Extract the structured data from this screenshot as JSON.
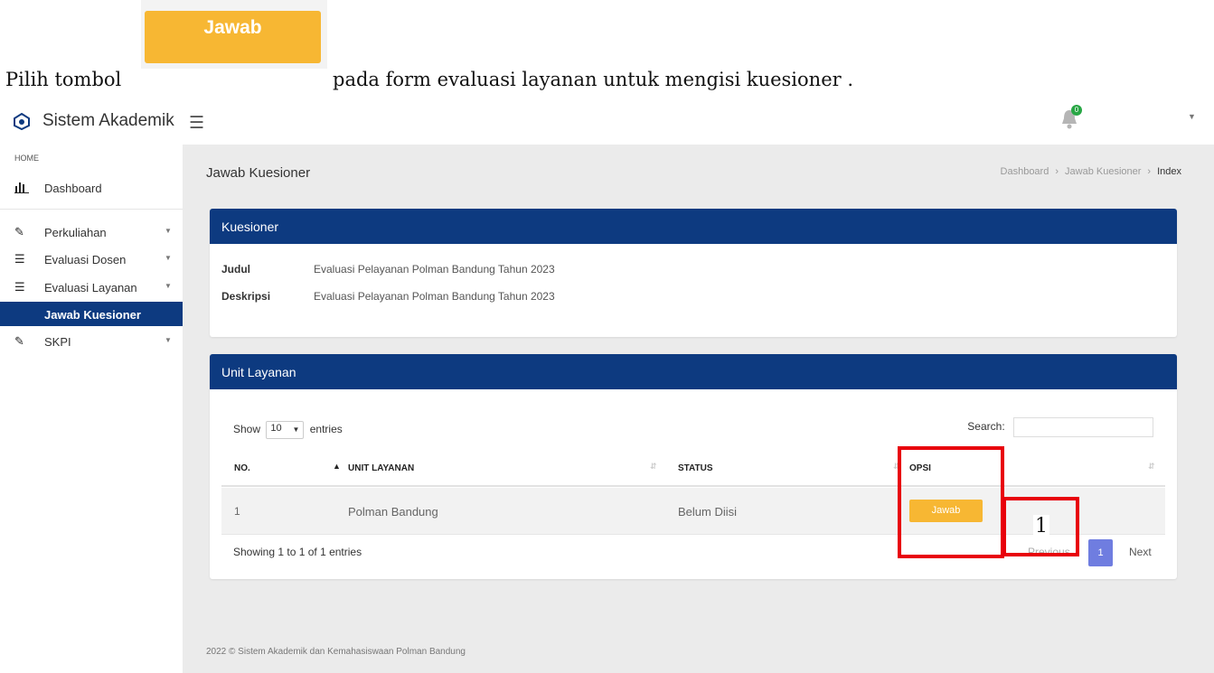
{
  "instruction": {
    "pre_text": "Pilih tombol",
    "button_label": "Jawab",
    "post_text": "pada form evaluasi layanan untuk mengisi kuesioner ."
  },
  "topbar": {
    "brand": "Sistem Akademik",
    "notification_count": "0"
  },
  "sidebar": {
    "header": "HOME",
    "items": [
      {
        "label": "Dashboard",
        "icon": "bar-chart-icon"
      },
      {
        "label": "Perkuliahan",
        "icon": "pencil-icon"
      },
      {
        "label": "Evaluasi Dosen",
        "icon": "list-icon"
      },
      {
        "label": "Evaluasi Layanan",
        "icon": "list-icon"
      },
      {
        "label": "Jawab Kuesioner",
        "active": true
      },
      {
        "label": "SKPI",
        "icon": "pencil-icon"
      }
    ]
  },
  "page": {
    "title": "Jawab Kuesioner",
    "breadcrumb": [
      "Dashboard",
      "Jawab Kuesioner",
      "Index"
    ]
  },
  "kuesioner": {
    "header": "Kuesioner",
    "judul_label": "Judul",
    "judul_value": "Evaluasi Pelayanan Polman Bandung Tahun 2023",
    "deskripsi_label": "Deskripsi",
    "deskripsi_value": "Evaluasi Pelayanan Polman Bandung Tahun 2023"
  },
  "unit_layanan": {
    "header": "Unit Layanan",
    "show_label": "Show",
    "entries_value": "10",
    "entries_label": "entries",
    "search_label": "Search:",
    "columns": [
      "NO.",
      "UNIT LAYANAN",
      "STATUS",
      "OPSI"
    ],
    "rows": [
      {
        "no": "1",
        "unit": "Polman Bandung",
        "status": "Belum Diisi",
        "action": "Jawab"
      }
    ],
    "info": "Showing 1 to 1 of 1 entries",
    "prev_label": "Previous",
    "page": "1",
    "next_label": "Next"
  },
  "annotation": {
    "step_number": "1",
    "color": "#e8000b"
  },
  "footer": "2022 © Sistem Akademik dan Kemahasiswaan Polman Bandung",
  "colors": {
    "primary": "#0d3a80",
    "accent_button": "#f7b733",
    "pager_active": "#6f7de0"
  }
}
